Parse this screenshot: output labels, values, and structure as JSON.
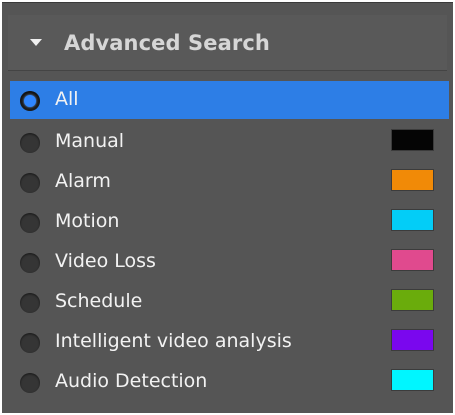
{
  "panel": {
    "title": "Advanced Search",
    "expanded": true,
    "caret_icon": "triangle-down-icon"
  },
  "options": [
    {
      "label": "All",
      "selected": true,
      "color": null
    },
    {
      "label": "Manual",
      "selected": false,
      "color": "#050505"
    },
    {
      "label": "Alarm",
      "selected": false,
      "color": "#f18a07"
    },
    {
      "label": "Motion",
      "selected": false,
      "color": "#03cdf7"
    },
    {
      "label": "Video Loss",
      "selected": false,
      "color": "#e04a8e"
    },
    {
      "label": "Schedule",
      "selected": false,
      "color": "#6aac0c"
    },
    {
      "label": "Intelligent video analysis",
      "selected": false,
      "color": "#7a07ee"
    },
    {
      "label": "Audio Detection",
      "selected": false,
      "color": "#00f6ff"
    }
  ],
  "colors": {
    "selected_row": "#2d7ee6",
    "panel_background": "#555555"
  }
}
